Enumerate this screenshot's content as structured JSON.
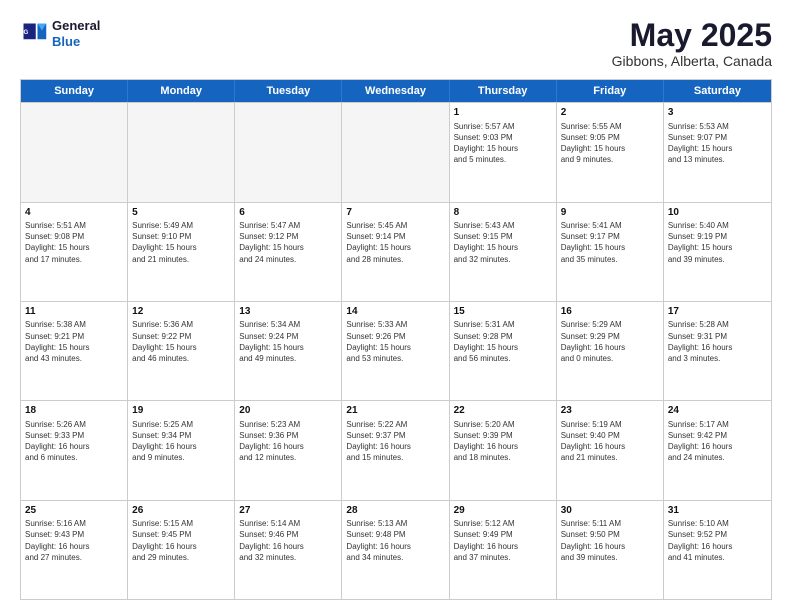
{
  "header": {
    "logo_line1": "General",
    "logo_line2": "Blue",
    "title": "May 2025",
    "subtitle": "Gibbons, Alberta, Canada"
  },
  "days_of_week": [
    "Sunday",
    "Monday",
    "Tuesday",
    "Wednesday",
    "Thursday",
    "Friday",
    "Saturday"
  ],
  "rows": [
    {
      "cells": [
        {
          "day": "",
          "info": "",
          "shaded": true
        },
        {
          "day": "",
          "info": "",
          "shaded": true
        },
        {
          "day": "",
          "info": "",
          "shaded": true
        },
        {
          "day": "",
          "info": "",
          "shaded": true
        },
        {
          "day": "1",
          "info": "Sunrise: 5:57 AM\nSunset: 9:03 PM\nDaylight: 15 hours\nand 5 minutes.",
          "shaded": false
        },
        {
          "day": "2",
          "info": "Sunrise: 5:55 AM\nSunset: 9:05 PM\nDaylight: 15 hours\nand 9 minutes.",
          "shaded": false
        },
        {
          "day": "3",
          "info": "Sunrise: 5:53 AM\nSunset: 9:07 PM\nDaylight: 15 hours\nand 13 minutes.",
          "shaded": false
        }
      ]
    },
    {
      "cells": [
        {
          "day": "4",
          "info": "Sunrise: 5:51 AM\nSunset: 9:08 PM\nDaylight: 15 hours\nand 17 minutes.",
          "shaded": false
        },
        {
          "day": "5",
          "info": "Sunrise: 5:49 AM\nSunset: 9:10 PM\nDaylight: 15 hours\nand 21 minutes.",
          "shaded": false
        },
        {
          "day": "6",
          "info": "Sunrise: 5:47 AM\nSunset: 9:12 PM\nDaylight: 15 hours\nand 24 minutes.",
          "shaded": false
        },
        {
          "day": "7",
          "info": "Sunrise: 5:45 AM\nSunset: 9:14 PM\nDaylight: 15 hours\nand 28 minutes.",
          "shaded": false
        },
        {
          "day": "8",
          "info": "Sunrise: 5:43 AM\nSunset: 9:15 PM\nDaylight: 15 hours\nand 32 minutes.",
          "shaded": false
        },
        {
          "day": "9",
          "info": "Sunrise: 5:41 AM\nSunset: 9:17 PM\nDaylight: 15 hours\nand 35 minutes.",
          "shaded": false
        },
        {
          "day": "10",
          "info": "Sunrise: 5:40 AM\nSunset: 9:19 PM\nDaylight: 15 hours\nand 39 minutes.",
          "shaded": false
        }
      ]
    },
    {
      "cells": [
        {
          "day": "11",
          "info": "Sunrise: 5:38 AM\nSunset: 9:21 PM\nDaylight: 15 hours\nand 43 minutes.",
          "shaded": false
        },
        {
          "day": "12",
          "info": "Sunrise: 5:36 AM\nSunset: 9:22 PM\nDaylight: 15 hours\nand 46 minutes.",
          "shaded": false
        },
        {
          "day": "13",
          "info": "Sunrise: 5:34 AM\nSunset: 9:24 PM\nDaylight: 15 hours\nand 49 minutes.",
          "shaded": false
        },
        {
          "day": "14",
          "info": "Sunrise: 5:33 AM\nSunset: 9:26 PM\nDaylight: 15 hours\nand 53 minutes.",
          "shaded": false
        },
        {
          "day": "15",
          "info": "Sunrise: 5:31 AM\nSunset: 9:28 PM\nDaylight: 15 hours\nand 56 minutes.",
          "shaded": false
        },
        {
          "day": "16",
          "info": "Sunrise: 5:29 AM\nSunset: 9:29 PM\nDaylight: 16 hours\nand 0 minutes.",
          "shaded": false
        },
        {
          "day": "17",
          "info": "Sunrise: 5:28 AM\nSunset: 9:31 PM\nDaylight: 16 hours\nand 3 minutes.",
          "shaded": false
        }
      ]
    },
    {
      "cells": [
        {
          "day": "18",
          "info": "Sunrise: 5:26 AM\nSunset: 9:33 PM\nDaylight: 16 hours\nand 6 minutes.",
          "shaded": false
        },
        {
          "day": "19",
          "info": "Sunrise: 5:25 AM\nSunset: 9:34 PM\nDaylight: 16 hours\nand 9 minutes.",
          "shaded": false
        },
        {
          "day": "20",
          "info": "Sunrise: 5:23 AM\nSunset: 9:36 PM\nDaylight: 16 hours\nand 12 minutes.",
          "shaded": false
        },
        {
          "day": "21",
          "info": "Sunrise: 5:22 AM\nSunset: 9:37 PM\nDaylight: 16 hours\nand 15 minutes.",
          "shaded": false
        },
        {
          "day": "22",
          "info": "Sunrise: 5:20 AM\nSunset: 9:39 PM\nDaylight: 16 hours\nand 18 minutes.",
          "shaded": false
        },
        {
          "day": "23",
          "info": "Sunrise: 5:19 AM\nSunset: 9:40 PM\nDaylight: 16 hours\nand 21 minutes.",
          "shaded": false
        },
        {
          "day": "24",
          "info": "Sunrise: 5:17 AM\nSunset: 9:42 PM\nDaylight: 16 hours\nand 24 minutes.",
          "shaded": false
        }
      ]
    },
    {
      "cells": [
        {
          "day": "25",
          "info": "Sunrise: 5:16 AM\nSunset: 9:43 PM\nDaylight: 16 hours\nand 27 minutes.",
          "shaded": false
        },
        {
          "day": "26",
          "info": "Sunrise: 5:15 AM\nSunset: 9:45 PM\nDaylight: 16 hours\nand 29 minutes.",
          "shaded": false
        },
        {
          "day": "27",
          "info": "Sunrise: 5:14 AM\nSunset: 9:46 PM\nDaylight: 16 hours\nand 32 minutes.",
          "shaded": false
        },
        {
          "day": "28",
          "info": "Sunrise: 5:13 AM\nSunset: 9:48 PM\nDaylight: 16 hours\nand 34 minutes.",
          "shaded": false
        },
        {
          "day": "29",
          "info": "Sunrise: 5:12 AM\nSunset: 9:49 PM\nDaylight: 16 hours\nand 37 minutes.",
          "shaded": false
        },
        {
          "day": "30",
          "info": "Sunrise: 5:11 AM\nSunset: 9:50 PM\nDaylight: 16 hours\nand 39 minutes.",
          "shaded": false
        },
        {
          "day": "31",
          "info": "Sunrise: 5:10 AM\nSunset: 9:52 PM\nDaylight: 16 hours\nand 41 minutes.",
          "shaded": false
        }
      ]
    }
  ]
}
